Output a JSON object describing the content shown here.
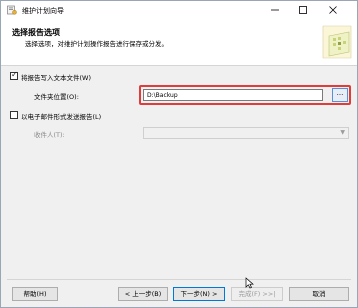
{
  "window": {
    "title": "维护计划向导"
  },
  "header": {
    "title": "选择报告选项",
    "subtitle": "选择选项，对维护计划操作报告进行保存或分发。"
  },
  "options": {
    "write_report_label": "将报告写入文本文件(W)",
    "write_report_checked": true,
    "folder_label": "文件夹位置(O):",
    "folder_value": "D:\\Backup",
    "browse_label": "...",
    "email_label": "以电子邮件形式发送报告(L)",
    "email_checked": false,
    "recipient_label": "收件人(T):",
    "recipient_value": ""
  },
  "buttons": {
    "help": "帮助(H)",
    "back": "< 上一步(B)",
    "next": "下一步(N) >",
    "finish": "完成(F) >>|",
    "cancel": "取消"
  },
  "icons": {
    "app": "maintenance-wizard-icon",
    "minimize": "minimize-icon",
    "maximize": "maximize-icon",
    "close": "close-icon",
    "header_art": "wizard-decoration-icon",
    "cursor": "mouse-cursor-icon"
  },
  "colors": {
    "highlight": "#e03c3c",
    "accent": "#0078d7"
  }
}
